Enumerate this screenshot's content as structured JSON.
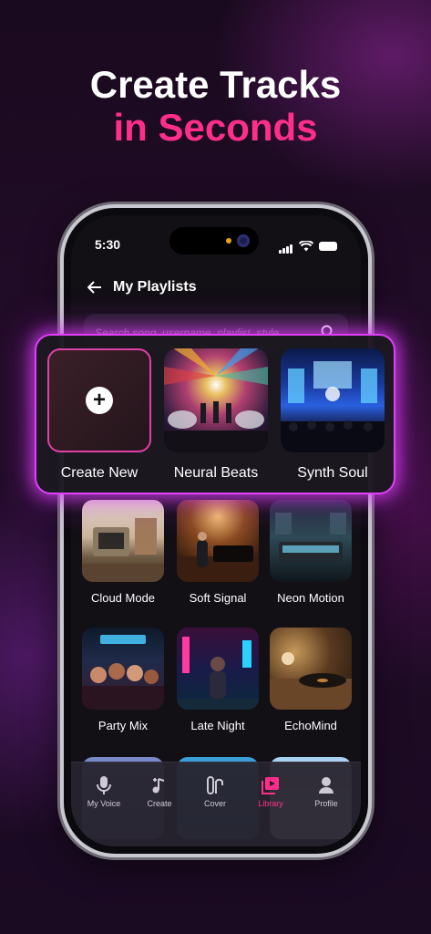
{
  "headline": {
    "line1": "Create Tracks",
    "line2": "in Seconds"
  },
  "status": {
    "time": "5:30"
  },
  "header": {
    "title": "My Playlists",
    "back_icon": "arrow-left-icon"
  },
  "search": {
    "placeholder": "Search song, username, playlist, style",
    "icon": "search-icon"
  },
  "featured": [
    {
      "label": "Create New",
      "icon": "plus-icon"
    },
    {
      "label": "Neural Beats"
    },
    {
      "label": "Synth Soul"
    }
  ],
  "playlists": [
    {
      "label": "Cloud Mode"
    },
    {
      "label": "Soft Signal"
    },
    {
      "label": "Neon Motion"
    },
    {
      "label": "Party Mix"
    },
    {
      "label": "Late Night"
    },
    {
      "label": "EchoMind"
    }
  ],
  "tabs": [
    {
      "label": "My Voice",
      "icon": "microphone-icon"
    },
    {
      "label": "Create",
      "icon": "music-plus-icon"
    },
    {
      "label": "Cover",
      "icon": "cover-icon"
    },
    {
      "label": "Library",
      "icon": "library-icon",
      "active": true
    },
    {
      "label": "Profile",
      "icon": "profile-icon"
    }
  ],
  "colors": {
    "accent": "#ff2e8a",
    "glow": "#e040fb",
    "background": "#1a0a1f"
  }
}
